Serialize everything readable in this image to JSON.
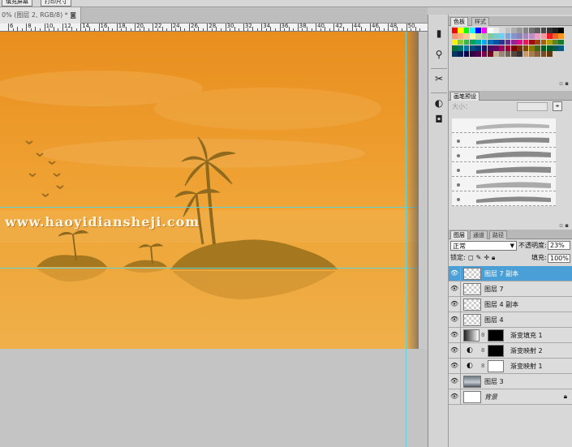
{
  "options_bar": {
    "fill_screen_button": "填充屏幕",
    "print_size_button": "打印尺寸"
  },
  "document": {
    "tab_title": "0% (图层 2, RGB/8) * ◙"
  },
  "ruler": {
    "labels": [
      "6",
      "8",
      "10",
      "12",
      "14",
      "16",
      "18",
      "20",
      "22",
      "24",
      "26",
      "28",
      "30",
      "32",
      "34",
      "36",
      "38",
      "40",
      "42",
      "44",
      "46",
      "48",
      "50"
    ]
  },
  "canvas": {
    "watermark": "www.haoyidiansheji.com"
  },
  "tools": [
    "histogram-icon",
    "info-icon",
    "tool-presets-icon",
    "brushes-icon",
    "clone-source-icon"
  ],
  "swatch_panel": {
    "tabs": [
      "色板",
      "样式"
    ],
    "colors": [
      "#ff0000",
      "#ffff00",
      "#00ff00",
      "#00ffff",
      "#0000ff",
      "#ff00ff",
      "#ffffff",
      "#ebebeb",
      "#d6d6d6",
      "#c2c2c2",
      "#adadad",
      "#999999",
      "#858585",
      "#707070",
      "#5c5c5c",
      "#474747",
      "#333333",
      "#1f1f1f",
      "#000000",
      "#f7977a",
      "#f9ad81",
      "#fdc68a",
      "#fff79a",
      "#c4df9b",
      "#a3d39c",
      "#82ca9d",
      "#7bcdc8",
      "#6ecff6",
      "#7ea7d8",
      "#8493ca",
      "#8882be",
      "#a187be",
      "#bc8dbf",
      "#f49ac2",
      "#f6989d",
      "#ed1c24",
      "#f26522",
      "#f7941d",
      "#fff200",
      "#8dc63f",
      "#39b54a",
      "#00a651",
      "#00a99d",
      "#00aeef",
      "#0072bc",
      "#0054a6",
      "#2e3192",
      "#662d91",
      "#92278f",
      "#ec008c",
      "#ed145b",
      "#9e0b0f",
      "#a0410d",
      "#a36209",
      "#aba000",
      "#598527",
      "#1a7b30",
      "#007236",
      "#00746b",
      "#0076a3",
      "#004b80",
      "#003471",
      "#1b1464",
      "#440e62",
      "#630460",
      "#9e005d",
      "#9e0039",
      "#790000",
      "#7b2e00",
      "#7d4900",
      "#827b00",
      "#406618",
      "#005e20",
      "#005826",
      "#005952",
      "#005b7f",
      "#003663",
      "#002157",
      "#0d004c",
      "#32004b",
      "#4b0049",
      "#7b0046",
      "#7a0026",
      "#c7b299",
      "#998675",
      "#736357",
      "#534741",
      "#37302d",
      "#c69c6d",
      "#a67c52",
      "#8c6239",
      "#754c24",
      "#603913"
    ]
  },
  "brush_panel": {
    "tabs": [
      "画笔预设"
    ],
    "size_label": "大小："
  },
  "layers_panel": {
    "tabs": [
      "图层",
      "通道",
      "路径"
    ],
    "blend_mode": "正常",
    "opacity_label": "不透明度:",
    "opacity_value": "23%",
    "lock_label": "锁定:",
    "fill_label": "填充:",
    "fill_value": "100%",
    "layers": [
      {
        "name": "图层 7 副本",
        "kind": "pixel",
        "selected": true
      },
      {
        "name": "图层 7",
        "kind": "pixel",
        "selected": false
      },
      {
        "name": "图层 4 副本",
        "kind": "pixel",
        "selected": false
      },
      {
        "name": "图层 4",
        "kind": "pixel",
        "selected": false
      },
      {
        "name": "渐变填充 1",
        "kind": "gradient-fill",
        "selected": false
      },
      {
        "name": "渐变映射 2",
        "kind": "gradient-map",
        "selected": false
      },
      {
        "name": "渐变映射 1",
        "kind": "gradient-map",
        "selected": false
      },
      {
        "name": "图层 3",
        "kind": "photo",
        "selected": false
      },
      {
        "name": "背景",
        "kind": "background",
        "selected": false
      }
    ]
  },
  "colors": {
    "selection": "#4aa0d6",
    "guide": "#5fd3dc"
  }
}
